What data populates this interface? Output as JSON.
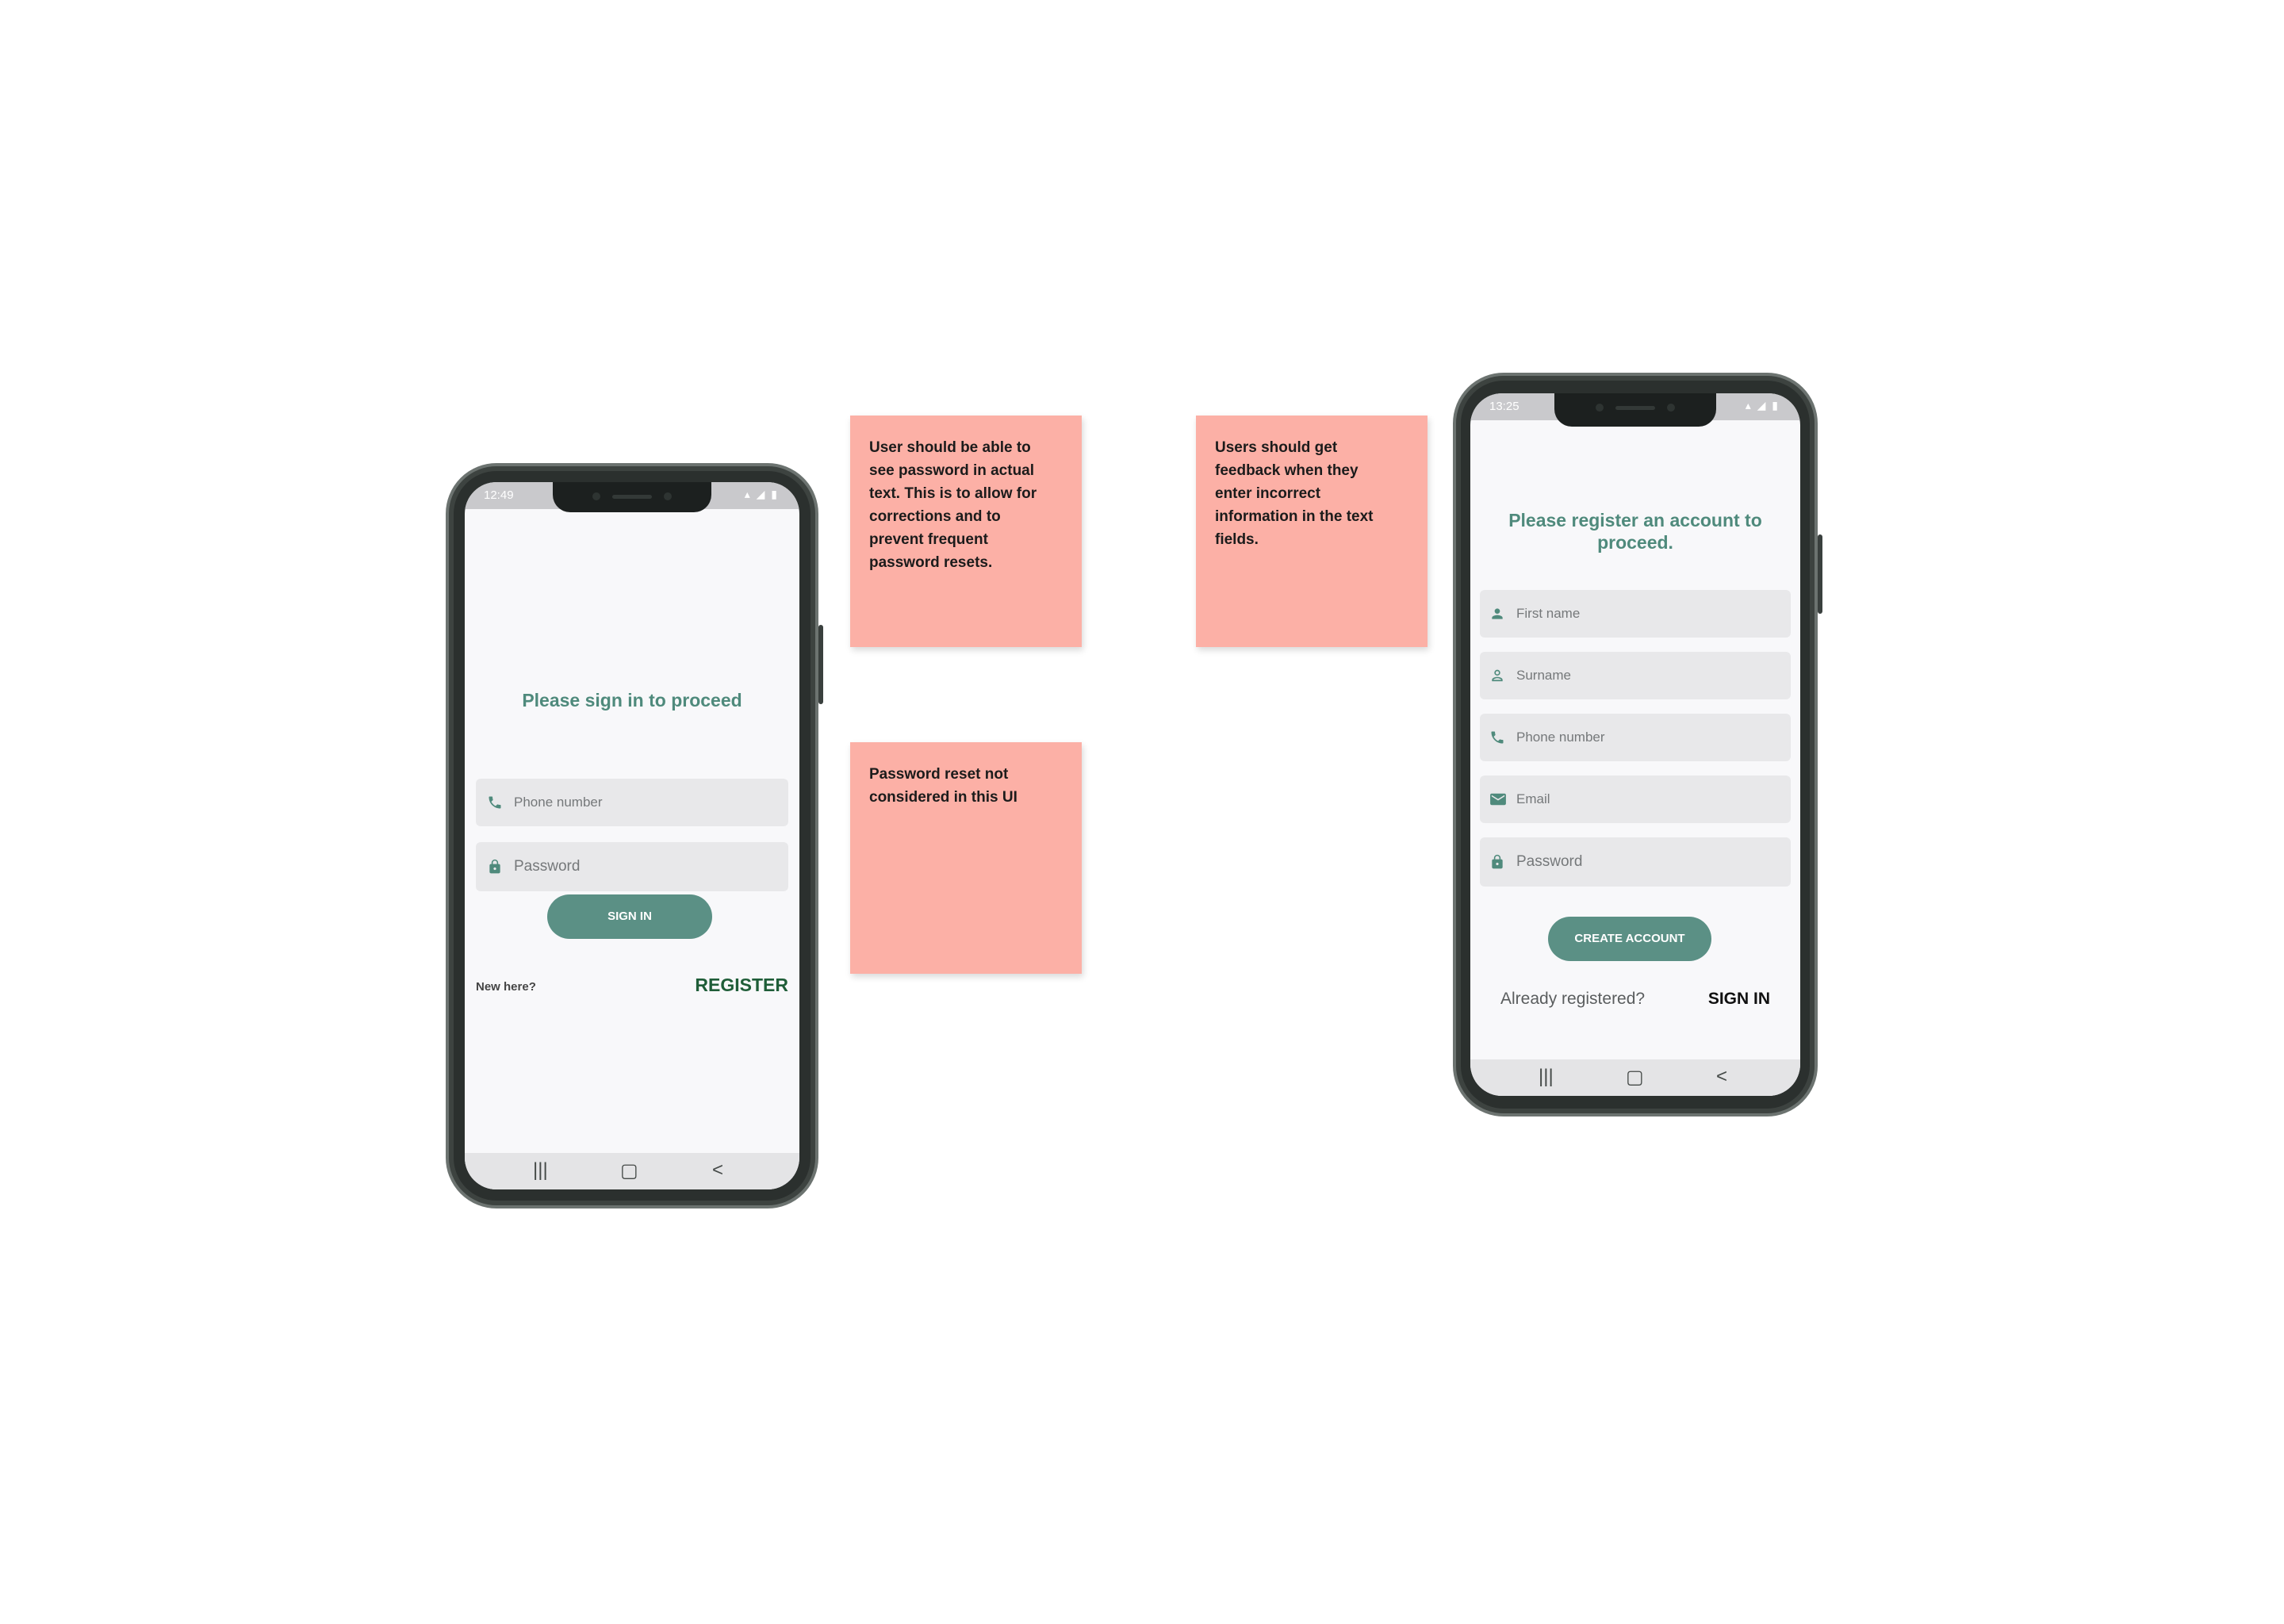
{
  "signin_screen": {
    "status_time": "12:49",
    "title": "Please sign in to proceed",
    "phone_placeholder": "Phone number",
    "password_placeholder": "Password",
    "signin_button": "SIGN IN",
    "new_here": "New here?",
    "register_link": "REGISTER"
  },
  "register_screen": {
    "status_time": "13:25",
    "title": "Please register an account to proceed.",
    "first_name_placeholder": "First name",
    "surname_placeholder": "Surname",
    "phone_placeholder": "Phone number",
    "email_placeholder": "Email",
    "password_placeholder": "Password",
    "create_button": "CREATE ACCOUNT",
    "already_registered": "Already registered?",
    "signin_link": "SIGN IN"
  },
  "notes": {
    "password_visibility": "User should be able to\nsee password in actual\ntext. This is to allow for\ncorrections and to\nprevent frequent\npassword resets.",
    "password_reset": "Password reset not\nconsidered in this UI",
    "feedback": "Users should get\nfeedback when they\nenter incorrect\ninformation in the text\nfields."
  },
  "nav_icons": {
    "recent": "|||",
    "home": "▢",
    "back": "<"
  },
  "icons": {
    "phone": "phone-icon",
    "lock": "lock-icon",
    "person": "person-icon",
    "person_outline": "person-outline-icon",
    "email": "email-icon"
  },
  "colors": {
    "accent": "#4f8a7c",
    "button": "#5b9085",
    "note": "#fcb0a6",
    "register_link": "#1f5d38"
  }
}
